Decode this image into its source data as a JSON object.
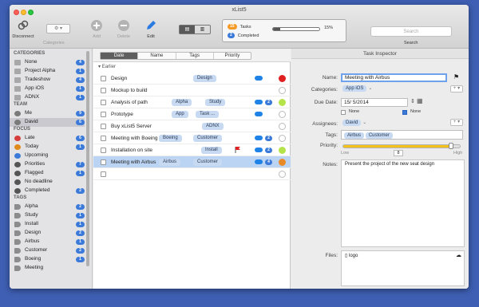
{
  "window": {
    "title": "xList5"
  },
  "toolbar": {
    "disconnect": "Disconnect",
    "categories": "Categories",
    "add": "Add",
    "delete": "Delete",
    "edit": "Edit",
    "search_placeholder": "Search",
    "search_label": "Search",
    "status": {
      "tasks_count": "15",
      "tasks_label": "Tasks",
      "completed_count": "2",
      "completed_label": "Completed",
      "progress_pct": "15%",
      "progress_value": 0.15
    }
  },
  "sidebar": {
    "categories_header": "CATEGORIES",
    "categories": [
      {
        "label": "None",
        "count": "4",
        "color": "#a8a8a8"
      },
      {
        "label": "Project Alpha",
        "count": "1",
        "color": "#a8a8a8"
      },
      {
        "label": "Tradeshow",
        "count": "4",
        "color": "#a8a8a8"
      },
      {
        "label": "App iOS",
        "count": "1",
        "color": "#a8a8a8"
      },
      {
        "label": "ADNX",
        "count": "1",
        "color": "#a8a8a8"
      }
    ],
    "team_header": "TEAM",
    "team": [
      {
        "label": "Me",
        "count": "9"
      },
      {
        "label": "David",
        "count": "6"
      }
    ],
    "focus_header": "FOCUS",
    "focus": [
      {
        "label": "Late",
        "count": "6",
        "color": "#d63c3c"
      },
      {
        "label": "Today",
        "count": "1",
        "color": "#e08a1b"
      },
      {
        "label": "Upcoming",
        "count": "",
        "color": "#3b7ad9"
      },
      {
        "label": "Priorities",
        "count": "7",
        "color": "#555555"
      },
      {
        "label": "Flagged",
        "count": "1",
        "color": "#555555"
      },
      {
        "label": "No deadline",
        "count": "",
        "color": "#555555"
      },
      {
        "label": "Completed",
        "count": "2",
        "color": "#555555"
      }
    ],
    "tags_header": "TAGS",
    "tags": [
      {
        "label": "Alpha",
        "count": "2"
      },
      {
        "label": "Study",
        "count": "1"
      },
      {
        "label": "Install",
        "count": "1"
      },
      {
        "label": "Design",
        "count": "2"
      },
      {
        "label": "Airbus",
        "count": "1"
      },
      {
        "label": "Customer",
        "count": "2"
      },
      {
        "label": "Boeing",
        "count": "1"
      },
      {
        "label": "Meeting",
        "count": ""
      }
    ]
  },
  "tasks": {
    "sort_tabs": [
      "Date",
      "Name",
      "Tags",
      "Priority"
    ],
    "group_label": "Earlier",
    "rows": [
      {
        "name": "Design",
        "tags": [
          "Design"
        ],
        "cloud": true,
        "count": "",
        "dot": "#e02020"
      },
      {
        "name": "Mockup to build",
        "tags": [],
        "cloud": false,
        "count": "",
        "dot": "#ffffff"
      },
      {
        "name": "Analysis of path",
        "tags": [
          "Alpha",
          "Study"
        ],
        "cloud": true,
        "count": "2",
        "dot": "#b5e34a"
      },
      {
        "name": "Prototype",
        "tags": [
          "App",
          "Task ..."
        ],
        "cloud": true,
        "count": "",
        "dot": "#ffffff"
      },
      {
        "name": "Buy xList5 Server",
        "tags": [
          "ADNX"
        ],
        "cloud": false,
        "count": "",
        "dot": "#ffffff"
      },
      {
        "name": "Meeting with Boeing",
        "tags": [
          "Boeing",
          "Customer"
        ],
        "cloud": true,
        "count": "2",
        "dot": "#ffffff"
      },
      {
        "name": "Installation on site",
        "tags": [
          "Install"
        ],
        "cloud": true,
        "count": "2",
        "dot": "#b5e34a"
      },
      {
        "name": "Meeting with Airbus",
        "tags": [
          "Airbus",
          "Customer"
        ],
        "cloud": true,
        "count": "4",
        "dot": "#e88a2a"
      },
      {
        "name": "",
        "tags": [],
        "cloud": false,
        "count": "",
        "dot": "#ffffff"
      }
    ]
  },
  "inspector": {
    "title": "Task Inspector",
    "name_label": "Name:",
    "name_value": "Meeting with Airbus",
    "categories_label": "Categories:",
    "categories_value": "App iOS",
    "due_label": "Due Date:",
    "due_value": "15/ 5/2014",
    "none1": "None",
    "none2": "None",
    "assignees_label": "Assignees:",
    "assignee": "David",
    "tags_label": "Tags:",
    "tags": [
      "Airbus",
      "Customer"
    ],
    "priority_label": "Priority:",
    "priority_value": 0.92,
    "priority_low": "Low",
    "priority_number": "8",
    "priority_high": "High",
    "notes_label": "Notes:",
    "notes_value": "Present the project of the new seat design",
    "files_label": "Files:",
    "file_name": "logo"
  }
}
